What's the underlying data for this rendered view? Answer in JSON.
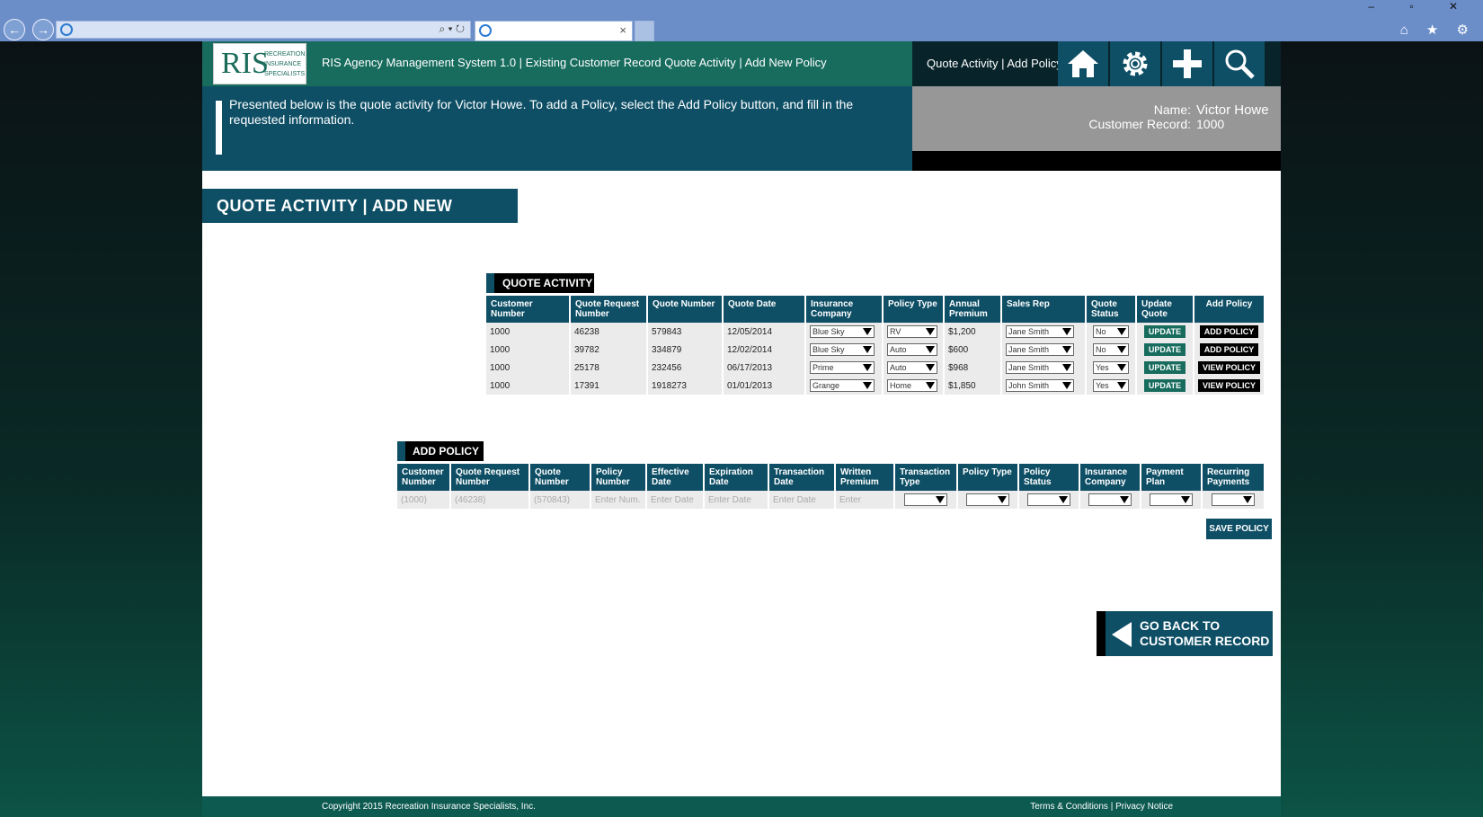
{
  "browser": {
    "back_icon": "back-arrow-icon",
    "forward_icon": "forward-arrow-icon",
    "address_tools": "⌕ ▾ ↻",
    "tab_close": "×",
    "window_controls": "– ▫ ✕",
    "favorites": "⌂ ★ ⚙"
  },
  "header": {
    "logo_big": "RIS",
    "logo_small": "RECREATION INSURANCE SPECIALISTS",
    "breadcrumb": "RIS Agency Management System 1.0 | Existing Customer Record Quote Activity | Add New Policy",
    "right_label": "Quote Activity | Add Policy",
    "icons": [
      "home-icon",
      "gear-icon",
      "plus-icon",
      "search-icon"
    ]
  },
  "info": {
    "text": "Presented below is the quote activity for Victor Howe. To add a Policy, select the Add Policy button, and fill in the requested information."
  },
  "customer": {
    "name_label": "Name:",
    "name_value": "Victor Howe",
    "record_label": "Customer Record:",
    "record_value": "1000"
  },
  "section_title": "QUOTE ACTIVITY | ADD NEW POLICY",
  "quote_activity": {
    "title": "QUOTE ACTIVITY",
    "headers": [
      "Customer Number",
      "Quote Request Number",
      "Quote Number",
      "Quote Date",
      "Insurance Company",
      "Policy Type",
      "Annual Premium",
      "Sales Rep",
      "Quote Status",
      "Update Quote",
      "Add Policy"
    ],
    "rows": [
      {
        "customer": "1000",
        "request": "46238",
        "quote": "579843",
        "date": "12/05/2014",
        "company": "Blue Sky",
        "type": "RV",
        "premium": "$1,200",
        "rep": "Jane Smith",
        "status": "No",
        "update": "UPDATE",
        "action": "ADD POLICY"
      },
      {
        "customer": "1000",
        "request": "39782",
        "quote": "334879",
        "date": "12/02/2014",
        "company": "Blue Sky",
        "type": "Auto",
        "premium": "$600",
        "rep": "Jane Smith",
        "status": "No",
        "update": "UPDATE",
        "action": "ADD POLICY"
      },
      {
        "customer": "1000",
        "request": "25178",
        "quote": "232456",
        "date": "06/17/2013",
        "company": "Prime",
        "type": "Auto",
        "premium": "$968",
        "rep": "Jane Smith",
        "status": "Yes",
        "update": "UPDATE",
        "action": "VIEW POLICY"
      },
      {
        "customer": "1000",
        "request": "17391",
        "quote": "1918273",
        "date": "01/01/2013",
        "company": "Grange",
        "type": "Home",
        "premium": "$1,850",
        "rep": "John Smith",
        "status": "Yes",
        "update": "UPDATE",
        "action": "VIEW POLICY"
      }
    ]
  },
  "add_policy": {
    "title": "ADD POLICY",
    "headers": [
      "Customer Number",
      "Quote Request Number",
      "Quote Number",
      "Policy Number",
      "Effective Date",
      "Expiration Date",
      "Transaction Date",
      "Written Premium",
      "Transaction Type",
      "Policy Type",
      "Policy Status",
      "Insurance Company",
      "Payment Plan",
      "Recurring Payments"
    ],
    "values": {
      "customer": "(1000)",
      "request": "(46238)",
      "quote": "(570843)",
      "policy_number_placeholder": "Enter Num.",
      "effective_placeholder": "Enter Date",
      "expiration_placeholder": "Enter Date",
      "transaction_placeholder": "Enter Date",
      "premium_placeholder": "Enter"
    },
    "save": "SAVE POLICY"
  },
  "go_back": {
    "line1": "GO BACK TO",
    "line2": "CUSTOMER RECORD"
  },
  "footer": {
    "copyright": "Copyright 2015 Recreation Insurance Specialists, Inc.",
    "terms": "Terms & Conditions",
    "separator": "|",
    "privacy": "Privacy Notice"
  }
}
